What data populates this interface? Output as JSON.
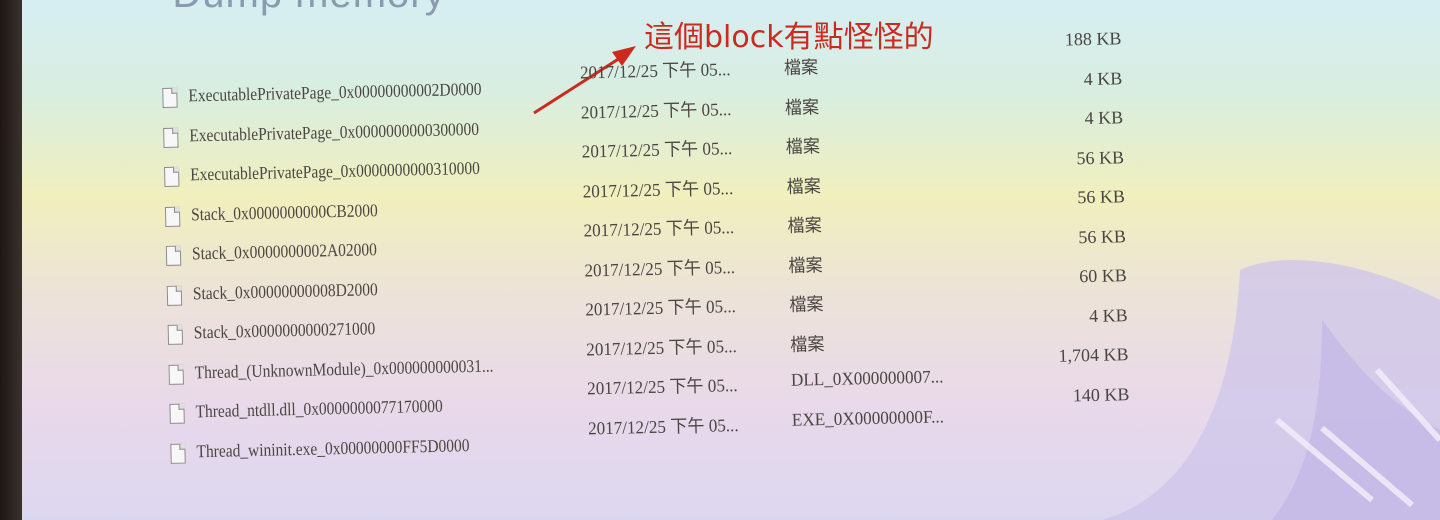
{
  "slide": {
    "heading": "– Dump memory",
    "annotation": "這個block有點怪怪的"
  },
  "files": [
    {
      "name": "ExecutablePrivatePage_0x00000000002D0000",
      "date": "2017/12/25 下午 05...",
      "type": "檔案",
      "size": "188 KB"
    },
    {
      "name": "ExecutablePrivatePage_0x0000000000300000",
      "date": "2017/12/25 下午 05...",
      "type": "檔案",
      "size": "4 KB"
    },
    {
      "name": "ExecutablePrivatePage_0x0000000000310000",
      "date": "2017/12/25 下午 05...",
      "type": "檔案",
      "size": "4 KB"
    },
    {
      "name": "Stack_0x0000000000CB2000",
      "date": "2017/12/25 下午 05...",
      "type": "檔案",
      "size": "56 KB"
    },
    {
      "name": "Stack_0x0000000002A02000",
      "date": "2017/12/25 下午 05...",
      "type": "檔案",
      "size": "56 KB"
    },
    {
      "name": "Stack_0x00000000008D2000",
      "date": "2017/12/25 下午 05...",
      "type": "檔案",
      "size": "56 KB"
    },
    {
      "name": "Stack_0x0000000000271000",
      "date": "2017/12/25 下午 05...",
      "type": "檔案",
      "size": "60 KB"
    },
    {
      "name": "Thread_(UnknownModule)_0x000000000031...",
      "date": "2017/12/25 下午 05...",
      "type": "檔案",
      "size": "4 KB"
    },
    {
      "name": "Thread_ntdll.dll_0x0000000077170000",
      "date": "2017/12/25 下午 05...",
      "type": "DLL_0X000000007...",
      "size": "1,704 KB"
    },
    {
      "name": "Thread_wininit.exe_0x00000000FF5D0000",
      "date": "2017/12/25 下午 05...",
      "type": "EXE_0X00000000F...",
      "size": "140 KB"
    }
  ],
  "colors": {
    "annotation": "#cc2a1e",
    "text": "#4a4642"
  }
}
